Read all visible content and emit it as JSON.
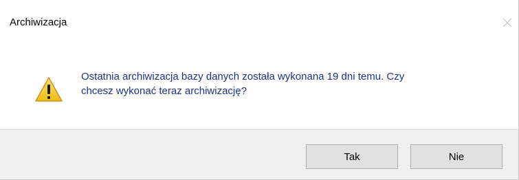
{
  "window": {
    "title": "Archiwizacja",
    "close_icon": "close-icon"
  },
  "message": {
    "icon": "warning-icon",
    "line1": "Ostatnia archiwizacja bazy danych została wykonana 19 dni temu. Czy",
    "line2": "chcesz wykonać teraz archiwizację?"
  },
  "buttons": {
    "yes_label": "Tak",
    "no_label": "Nie"
  },
  "colors": {
    "message_text": "#1e3287",
    "footer_background": "#f0f0f0",
    "button_background": "#e1e1e1",
    "warning_yellow": "#f7d12c"
  }
}
